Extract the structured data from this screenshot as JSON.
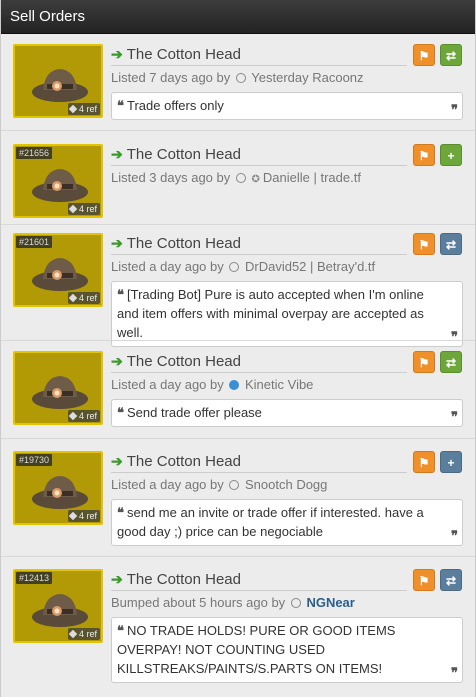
{
  "panel": {
    "title": "Sell Orders"
  },
  "listings": [
    {
      "thumb_id": "",
      "refs": "4 ref",
      "item_name": "The Cotton Head",
      "listed": "Listed 7 days ago by",
      "user": "Yesterday Racoonz",
      "action_icon": "swap-icon",
      "message": "Trade offers only"
    },
    {
      "thumb_id": "#21656",
      "refs": "4 ref",
      "item_name": "The Cotton Head",
      "listed": "Listed 3 days ago by",
      "user": "Danielle | trade.tf",
      "action_icon": "plus-icon",
      "message": ""
    },
    {
      "thumb_id": "#21601",
      "refs": "4 ref",
      "item_name": "The Cotton Head",
      "listed": "Listed a day ago by",
      "user": "DrDavid52 | Betray'd.tf",
      "action_icon": "swap-icon",
      "message": "[Trading Bot] Pure is auto accepted when I'm online and item offers with minimal overpay are accepted as well."
    },
    {
      "thumb_id": "",
      "refs": "4 ref",
      "item_name": "The Cotton Head",
      "listed": "Listed a day ago by",
      "user": "Kinetic Vibe",
      "action_icon": "swap-icon",
      "message": "Send trade offer please"
    },
    {
      "thumb_id": "#19730",
      "refs": "4 ref",
      "item_name": "The Cotton Head",
      "listed": "Listed a day ago by",
      "user": "Snootch Dogg",
      "action_icon": "plus-icon",
      "message": "send me an invite or trade offer if interested. have a good day ;) price can be negociable"
    },
    {
      "thumb_id": "#12413",
      "refs": "4 ref",
      "item_name": "The Cotton Head",
      "listed": "Bumped about 5 hours ago by",
      "user": "NGNear",
      "action_icon": "swap-icon",
      "message": "NO TRADE HOLDS! PURE OR GOOD ITEMS OVERPAY! NOT COUNTING USED KILLSTREAKS/PAINTS/S.PARTS ON ITEMS!"
    }
  ],
  "colors": {
    "accent_green": "#3b9a2c",
    "flag_orange": "#f0902a",
    "btn_green": "#6da63a",
    "btn_blue": "#5b7e9d",
    "thumb_gold": "#b19a06"
  }
}
